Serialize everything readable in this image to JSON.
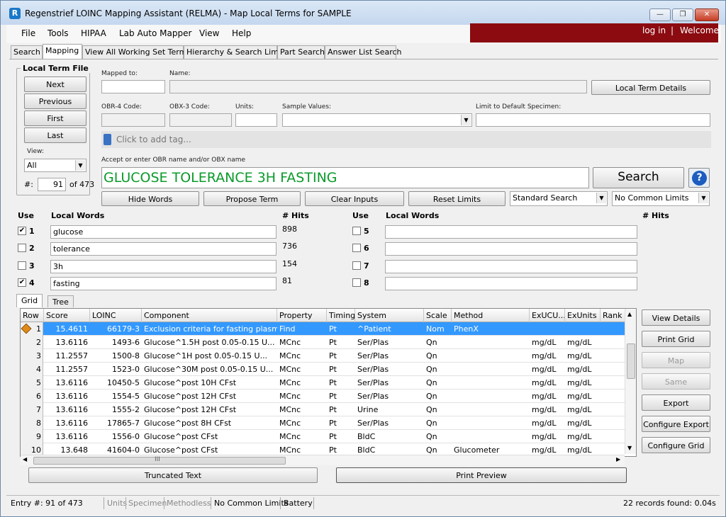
{
  "window": {
    "title": "Regenstrief LOINC Mapping Assistant (RELMA) - Map Local Terms  for SAMPLE",
    "min": "—",
    "max": "❐",
    "close": "✕"
  },
  "menu": [
    "File",
    "Tools",
    "HIPAA",
    "Lab Auto Mapper",
    "View",
    "Help"
  ],
  "login": {
    "login": "log in",
    "sep": "|",
    "welcome": "Welcome"
  },
  "tabs": [
    "Search",
    "Mapping",
    "View All Working Set Terms",
    "Hierarchy & Search Limits",
    "Part Search",
    "Answer List Search"
  ],
  "local_term_file": {
    "title": "Local Term File",
    "buttons": [
      "Next",
      "Previous",
      "First",
      "Last"
    ],
    "view_label": "View:",
    "view_value": "All",
    "record_label": "#:",
    "record_value": "91",
    "record_of": "of 473"
  },
  "fields": {
    "mapped_to_label": "Mapped to:",
    "mapped_to_value": "",
    "name_label": "Name:",
    "name_value": "",
    "local_term_details": "Local Term Details",
    "obr4_label": "OBR-4 Code:",
    "obx3_label": "OBX-3 Code:",
    "units_label": "Units:",
    "sample_values_label": "Sample Values:",
    "limit_specimen_label": "Limit to Default Specimen:"
  },
  "tag_placeholder": "Click to add tag...",
  "obr_label": "Accept or enter OBR name and/or OBX name",
  "search_text": "GLUCOSE TOLERANCE 3H FASTING",
  "search_button": "Search",
  "help_icon": "?",
  "action_buttons": [
    "Hide Words",
    "Propose Term",
    "Clear Inputs",
    "Reset Limits"
  ],
  "search_type": "Standard Search",
  "common_limits": "No Common Limits",
  "words_header": {
    "use": "Use",
    "local_words": "Local Words",
    "hits": "# Hits"
  },
  "words_left": [
    {
      "n": "1",
      "checked": true,
      "word": "glucose",
      "hits": "898"
    },
    {
      "n": "2",
      "checked": false,
      "word": "tolerance",
      "hits": "736"
    },
    {
      "n": "3",
      "checked": false,
      "word": "3h",
      "hits": "154"
    },
    {
      "n": "4",
      "checked": true,
      "word": "fasting",
      "hits": "81"
    }
  ],
  "words_right": [
    {
      "n": "5",
      "checked": false,
      "word": ""
    },
    {
      "n": "6",
      "checked": false,
      "word": ""
    },
    {
      "n": "7",
      "checked": false,
      "word": ""
    },
    {
      "n": "8",
      "checked": false,
      "word": ""
    }
  ],
  "grid_tabs": [
    "Grid",
    "Tree"
  ],
  "grid_columns": [
    "Row",
    "Score",
    "LOINC",
    "Component",
    "Property",
    "Timing",
    "System",
    "Scale",
    "Method",
    "ExUCU...",
    "ExUnits",
    "Rank"
  ],
  "grid_rows": [
    [
      "1",
      "15.4611",
      "66179-3",
      "Exclusion criteria for fasting plasma...",
      "Find",
      "Pt",
      "^Patient",
      "Nom",
      "PhenX",
      "",
      "",
      ""
    ],
    [
      "2",
      "13.6116",
      "1493-6",
      "Glucose^1.5H post 0.05-0.15 U...",
      "MCnc",
      "Pt",
      "Ser/Plas",
      "Qn",
      "",
      "mg/dL",
      "mg/dL",
      ""
    ],
    [
      "3",
      "11.2557",
      "1500-8",
      "Glucose^1H post 0.05-0.15 U...",
      "MCnc",
      "Pt",
      "Ser/Plas",
      "Qn",
      "",
      "mg/dL",
      "mg/dL",
      ""
    ],
    [
      "4",
      "11.2557",
      "1523-0",
      "Glucose^30M post 0.05-0.15 U...",
      "MCnc",
      "Pt",
      "Ser/Plas",
      "Qn",
      "",
      "mg/dL",
      "mg/dL",
      ""
    ],
    [
      "5",
      "13.6116",
      "10450-5",
      "Glucose^post 10H CFst",
      "MCnc",
      "Pt",
      "Ser/Plas",
      "Qn",
      "",
      "mg/dL",
      "mg/dL",
      ""
    ],
    [
      "6",
      "13.6116",
      "1554-5",
      "Glucose^post 12H CFst",
      "MCnc",
      "Pt",
      "Ser/Plas",
      "Qn",
      "",
      "mg/dL",
      "mg/dL",
      ""
    ],
    [
      "7",
      "13.6116",
      "1555-2",
      "Glucose^post 12H CFst",
      "MCnc",
      "Pt",
      "Urine",
      "Qn",
      "",
      "mg/dL",
      "mg/dL",
      ""
    ],
    [
      "8",
      "13.6116",
      "17865-7",
      "Glucose^post 8H CFst",
      "MCnc",
      "Pt",
      "Ser/Plas",
      "Qn",
      "",
      "mg/dL",
      "mg/dL",
      ""
    ],
    [
      "9",
      "13.6116",
      "1556-0",
      "Glucose^post CFst",
      "MCnc",
      "Pt",
      "BldC",
      "Qn",
      "",
      "mg/dL",
      "mg/dL",
      ""
    ],
    [
      "10",
      "13.648",
      "41604-0",
      "Glucose^post CFst",
      "MCnc",
      "Pt",
      "BldC",
      "Qn",
      "Glucometer",
      "mg/dL",
      "mg/dL",
      ""
    ]
  ],
  "side_buttons": [
    "View Details",
    "Print Grid",
    "Map",
    "Same",
    "Export",
    "Configure Export",
    "Configure Grid"
  ],
  "bottom_buttons": {
    "truncated": "Truncated Text",
    "print_preview": "Print Preview"
  },
  "status": {
    "entry": "Entry #: 91 of 473",
    "units": "Units",
    "specimen": "Specimen",
    "methodless": "Methodless",
    "common_limits": "No Common Limits",
    "battery": "Battery",
    "records": "22 records found: 0.04s"
  },
  "hscroll_mark": "III",
  "row_marker_icon": "diamond-arrow-icon"
}
